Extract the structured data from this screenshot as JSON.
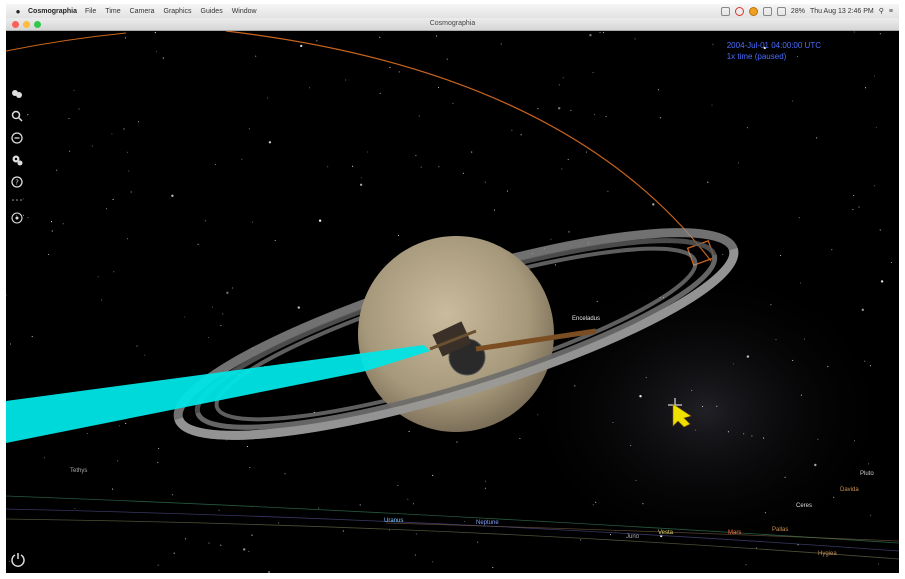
{
  "menubar": {
    "apple_icon": "apple-icon",
    "app_name": "Cosmographia",
    "items": [
      "File",
      "Time",
      "Camera",
      "Graphics",
      "Guides",
      "Window"
    ],
    "battery": "28%",
    "clock": "Thu Aug 13  2:46 PM"
  },
  "window": {
    "title": "Cosmographia"
  },
  "hud": {
    "date": "2004-Jul-01 04:00:00 UTC",
    "rate": "1x time (paused)"
  },
  "toolbar_icons": [
    "objects-icon",
    "search-icon",
    "minus-circle-icon",
    "settings-icon",
    "help-icon",
    "dots-icon",
    "target-icon"
  ],
  "labels": {
    "enceladus": "Enceladus",
    "tethys": "Tethys",
    "uranus": "Uranus",
    "neptune": "Neptune",
    "pluto": "Pluto",
    "davida": "Davida",
    "ceres": "Ceres",
    "vesta": "Vesta",
    "mars": "Mars",
    "hygiea": "Hygiea",
    "pallas": "Pallas",
    "juno": "Juno"
  },
  "colors": {
    "beam": "#00e5e5",
    "orbit": "#c8641e",
    "hud_text": "#4a6dff",
    "cursor": "#f0e000"
  }
}
